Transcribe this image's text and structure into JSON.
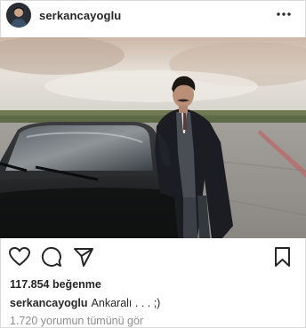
{
  "post": {
    "username": "serkancayoglu",
    "likes_text": "117.854 beğenme",
    "caption_user": "serkancayoglu",
    "caption_text": "Ankaralı . . . ;)",
    "comments_link": "1.720 yorumun tümünü gör"
  },
  "icons": {
    "more": "more-options-icon",
    "like": "heart-icon",
    "comment": "comment-icon",
    "share": "send-icon",
    "save": "bookmark-icon"
  },
  "colors": {
    "text": "#262626",
    "muted": "#8e8e8e",
    "border": "#dbdbdb"
  }
}
